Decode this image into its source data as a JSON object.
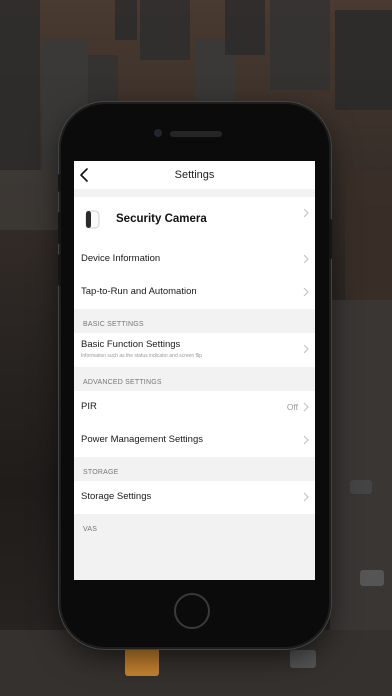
{
  "nav": {
    "title": "Settings",
    "back_icon": "chevron-left-icon"
  },
  "device": {
    "name": "Security Camera",
    "icon": "camera-icon"
  },
  "items_top": [
    {
      "label": "Device Information"
    },
    {
      "label": "Tap-to-Run and Automation"
    }
  ],
  "sections": {
    "basic": "BASIC SETTINGS",
    "advanced": "ADVANCED SETTINGS",
    "storage": "STORAGE",
    "vas": "VAS"
  },
  "basic_function": {
    "label": "Basic Function Settings",
    "sublabel": "Information such as the status indicator and screen flip"
  },
  "pir": {
    "label": "PIR",
    "value": "Off"
  },
  "power": {
    "label": "Power Management Settings"
  },
  "storage_settings": {
    "label": "Storage Settings"
  }
}
